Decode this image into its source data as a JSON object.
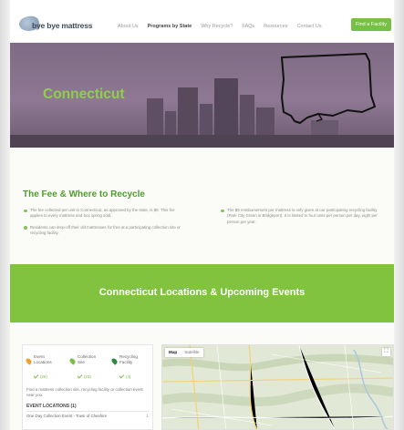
{
  "header": {
    "logo_text": "bye bye mattress",
    "nav": [
      {
        "label": "About Us",
        "active": false
      },
      {
        "label": "Programs by State",
        "active": true
      },
      {
        "label": "Why Recycle?",
        "active": false
      },
      {
        "label": "FAQs",
        "active": false
      },
      {
        "label": "Resources",
        "active": false
      },
      {
        "label": "Contact Us",
        "active": false
      }
    ],
    "cta_label": "Find a Facility"
  },
  "hero": {
    "title": "Connecticut"
  },
  "fee_section": {
    "title": "The Fee & Where to Recycle",
    "left_items": [
      "The fee collected per unit in Connecticut, as approved by the state, is $9. This fee applies to every mattress and box spring sold.",
      "Residents can drop-off their old mattresses for free at a participating collection site or recycling facility."
    ],
    "right_items": [
      "The $9 reimbursement per mattress is only given at our participating recycling facility (Park City Green in Bridgeport). It is limited to four units per person per day, eight per person per year."
    ]
  },
  "banner": {
    "title": "Connecticut Locations & Upcoming Events"
  },
  "locations": {
    "legend": [
      {
        "label": "Event Locations",
        "count": "(26)",
        "color": "#f0a030"
      },
      {
        "label": "Collection Site",
        "count": "(23)",
        "color": "#7cbc48"
      },
      {
        "label": "Recycling Facility",
        "count": "(3)",
        "color": "#2e8a3e"
      }
    ],
    "description": "Find a mattress collection site, recycling facility or collection event near you.",
    "list_heading": "EVENT LOCATIONS (1)",
    "events": [
      {
        "name": "One Day Collection Event - Town of Cheshire",
        "count": "1"
      }
    ]
  },
  "map": {
    "tabs": [
      "Map",
      "Satellite"
    ],
    "fullscreen_label": "⛶"
  },
  "colors": {
    "accent_green": "#81c33f",
    "hero_purple": "#7f6b84",
    "title_green": "#8fd04a"
  }
}
